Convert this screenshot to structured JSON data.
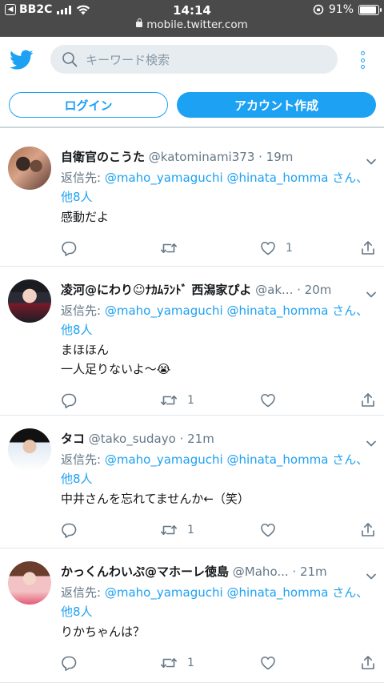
{
  "status_bar": {
    "back_app": "BB2C",
    "time": "14:14",
    "battery": "91%",
    "battery_level": 0.91,
    "url": "mobile.twitter.com"
  },
  "header": {
    "search_placeholder": "キーワード検索",
    "login_label": "ログイン",
    "signup_label": "アカウント作成"
  },
  "tweets": [
    {
      "name": "自衛官のこうた",
      "handle": "@katominami373",
      "time": "19m",
      "reply_prefix": "返信先:",
      "mention1": "@maho_yamaguchi",
      "mention2": "@hinata_homma",
      "reply_suffix": "さん、",
      "reply_others": "他8人",
      "text_lines": [
        "感動だよ"
      ],
      "retweet_count": "",
      "like_count": "1"
    },
    {
      "name": "凌河@にわり☺ﾅｶﾑﾗﾝﾄﾞ 西潟家ぴよ",
      "handle": "@ak...",
      "time": "20m",
      "reply_prefix": "返信先:",
      "mention1": "@maho_yamaguchi",
      "mention2": "@hinata_homma",
      "reply_suffix": "さん、",
      "reply_others": "他8人",
      "text_lines": [
        "まほほん",
        "一人足りないよ〜😭"
      ],
      "retweet_count": "1",
      "like_count": ""
    },
    {
      "name": "タコ",
      "handle": "@tako_sudayo",
      "time": "21m",
      "reply_prefix": "返信先:",
      "mention1": "@maho_yamaguchi",
      "mention2": "@hinata_homma",
      "reply_suffix": "さん、",
      "reply_others": "他8人",
      "text_lines": [
        "中井さんを忘れてませんか←（笑）"
      ],
      "retweet_count": "1",
      "like_count": ""
    },
    {
      "name": "かっくんわいぷ@マホーレ徳島",
      "handle": "@Maho...",
      "time": "21m",
      "reply_prefix": "返信先:",
      "mention1": "@maho_yamaguchi",
      "mention2": "@hinata_homma",
      "reply_suffix": "さん、",
      "reply_others": "他8人",
      "text_lines": [
        "りかちゃんは？"
      ],
      "retweet_count": "1",
      "like_count": ""
    }
  ],
  "icons": {
    "bird": "twitter-bird-icon",
    "search": "search-icon",
    "more": "more-vertical-icon",
    "reply": "reply-icon",
    "retweet": "retweet-icon",
    "like": "heart-icon",
    "share": "share-icon",
    "caret": "chevron-down-icon"
  },
  "colors": {
    "accent": "#1da1f2",
    "status_bar": "#4a4a4a",
    "muted": "#657786"
  }
}
